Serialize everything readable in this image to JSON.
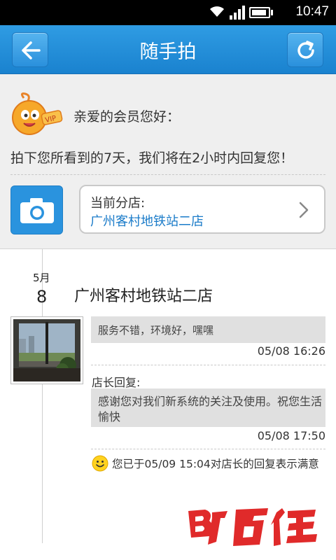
{
  "status_bar": {
    "time": "10:47"
  },
  "title_bar": {
    "title": "随手拍"
  },
  "header": {
    "greeting": "亲爱的会员您好：",
    "intro": "拍下您所看到的7天，我们将在2小时内回复您！",
    "store_label": "当前分店:",
    "store_name": "广州客村地铁站二店"
  },
  "post": {
    "month": "5月",
    "day": "8",
    "store": "广州客村地铁站二店",
    "comment": "服务不错，环境好，嘿嘿",
    "comment_time": "05/08 16:26",
    "reply_label": "店长回复:",
    "reply_text": "感谢您对我们新系统的关注及使用。祝您生活愉快",
    "reply_time": "05/08 17:50",
    "satisfaction": "您已于05/09 15:04对店长的回复表示满意"
  },
  "colors": {
    "accent": "#1a82cf",
    "link": "#1a7bc9"
  }
}
